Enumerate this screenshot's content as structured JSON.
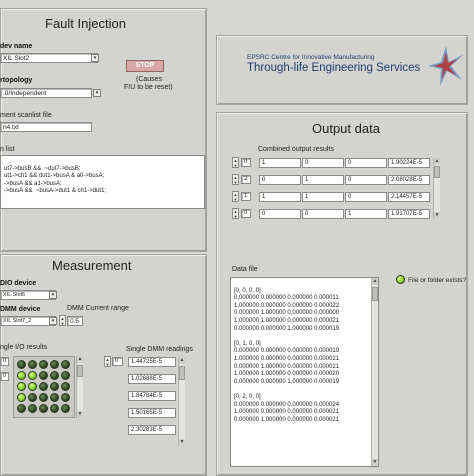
{
  "fault_injection": {
    "title": "Fault Injection",
    "subdev_label": "dev name",
    "subdev_value": "XIL Slot2",
    "topology_label": "rtopology",
    "topology_value": ".0/Independent",
    "stop_button": "STOP",
    "stop_note_1": "(Causes",
    "stop_note_2": "FIU to be reset)",
    "scanlist_file_label": "ment scanlist file",
    "scanlist_file_value": "n4.txt",
    "scanlist_label": "n list",
    "scanlist_lines": [
      "ut7->busB &&  ~dut7->busB;",
      "ut1->ch1 && dut1->busA & a0->busA;",
      "->busA && a1->busA;",
      "->busA &&  ~busA->dut1 & ch1->dut1;"
    ]
  },
  "logo": {
    "line1": "EPSRC Centre for Innovative Manufacturing",
    "line2": "Through-life Engineering Services"
  },
  "output": {
    "title": "Output data",
    "combined_label": "Combined output results",
    "index_values": [
      "0",
      "2",
      "1",
      "0"
    ],
    "rows": [
      [
        "1",
        "0",
        "0",
        "1.90224E-5"
      ],
      [
        "0",
        "1",
        "0",
        "2.08028E-5"
      ],
      [
        "1",
        "1",
        "0",
        "2.14457E-5"
      ],
      [
        "0",
        "0",
        "1",
        "1.91707E-5"
      ]
    ],
    "data_file_label": "Data file",
    "file_exists_label": "File or folder exists?",
    "data_file_lines": [
      "[0, 0, 0, 0]",
      "0.000000 0.000000 0.000000 0.000011",
      "1.000000 0.000000 0.000000 0.000022",
      "0.000000 1.000000 0.000000 0.000000",
      "1.000000 1.000000 0.000000 0.000021",
      "0.000000 0.000000 1.000000 0.000019",
      "",
      "[0, 1, 0, 0]",
      "0.000000 0.000000 0.000000 0.000019",
      "1.000000 0.000000 0.000000 0.000021",
      "0.000000 1.000000 0.000000 0.000021",
      "1.000000 1.000000 0.000000 0.000020",
      "0.000000 0.000000 1.000000 0.000019",
      "",
      "[0, 2, 0, 0]",
      "0.000000 0.000000 0.000000 0.000024",
      "1.000000 0.000000 0.000000 0.000021",
      "0.000000 1.000000 0.000000 0.000021"
    ]
  },
  "measurement": {
    "title": "Measurement",
    "dio_label": "DIO device",
    "dio_value": "XIL Slot6",
    "dmm_label": "DMM device",
    "dmm_value": "XIL Slot7_2",
    "dmm_range_label": "DMM Current range",
    "dmm_range_value": "0.5",
    "single_io_label": "ngle I/O results",
    "io_index_1": "0",
    "io_index_2": "0",
    "dmm_index": "0",
    "single_dmm_label": "Single DMM readings",
    "dmm_readings": [
      "1.44725E-5",
      "1.02688E-5",
      "1.84784E-5",
      "1.50165E-5",
      "2.30283E-5"
    ],
    "led_states": [
      [
        false,
        false,
        false,
        false,
        false
      ],
      [
        true,
        true,
        false,
        false,
        false
      ],
      [
        true,
        true,
        false,
        false,
        false
      ],
      [
        true,
        false,
        false,
        false,
        false
      ],
      [
        false,
        false,
        false,
        false,
        false
      ]
    ]
  }
}
